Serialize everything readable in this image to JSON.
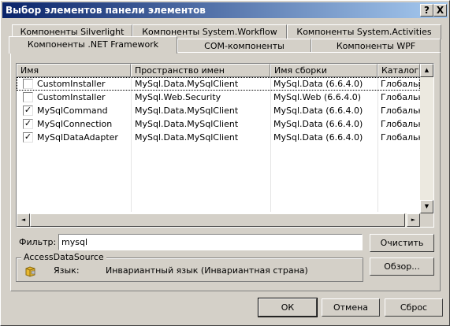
{
  "window": {
    "title": "Выбор элементов панели элементов",
    "help_button": "?",
    "close_button": "X"
  },
  "tabs": {
    "row_back": [
      "Компоненты Silverlight",
      "Компоненты System.Workflow",
      "Компоненты System.Activities"
    ],
    "row_front": [
      "Компоненты .NET Framework",
      "COM-компоненты",
      "Компоненты WPF"
    ],
    "active": "Компоненты .NET Framework"
  },
  "list": {
    "columns": [
      "Имя",
      "Пространство имен",
      "Имя сборки",
      "Каталог"
    ],
    "rows": [
      {
        "checked": false,
        "name": "CustomInstaller",
        "namespace": "MySql.Data.MySqlClient",
        "assembly": "MySql.Data (6.6.4.0)",
        "catalog": "Глобальны..."
      },
      {
        "checked": false,
        "name": "CustomInstaller",
        "namespace": "MySql.Web.Security",
        "assembly": "MySql.Web (6.6.4.0)",
        "catalog": "Глобальны..."
      },
      {
        "checked": true,
        "name": "MySqlCommand",
        "namespace": "MySql.Data.MySqlClient",
        "assembly": "MySql.Data (6.6.4.0)",
        "catalog": "Глобальны..."
      },
      {
        "checked": true,
        "name": "MySqlConnection",
        "namespace": "MySql.Data.MySqlClient",
        "assembly": "MySql.Data (6.6.4.0)",
        "catalog": "Глобальны..."
      },
      {
        "checked": true,
        "name": "MySqlDataAdapter",
        "namespace": "MySql.Data.MySqlClient",
        "assembly": "MySql.Data (6.6.4.0)",
        "catalog": "Глобальны..."
      }
    ],
    "checkmark": "✓"
  },
  "filter": {
    "label": "Фильтр:",
    "value": "mysql",
    "clear_button": "Очистить"
  },
  "details": {
    "component_name": "AccessDataSource",
    "language_label": "Язык:",
    "language_value": "Инвариантный язык (Инвариантная страна)",
    "browse_button": "Обзор..."
  },
  "buttons": {
    "ok": "ОК",
    "cancel": "Отмена",
    "reset": "Сброс"
  },
  "icons": {
    "component_icon": "component-icon",
    "scroll_up": "▲",
    "scroll_down": "▼",
    "scroll_left": "◄",
    "scroll_right": "►"
  }
}
